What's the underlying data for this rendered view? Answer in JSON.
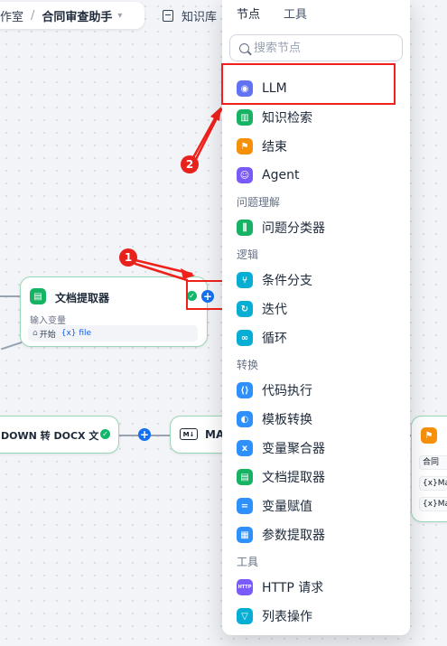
{
  "breadcrumb": {
    "studio": "作室",
    "app_name": "合同审查助手"
  },
  "toolbar": {
    "knowledge": "知识库"
  },
  "panel": {
    "tabs": [
      "节点",
      "工具"
    ],
    "search_placeholder": "搜索节点",
    "items": [
      {
        "label": "LLM",
        "icon": "brain-icon",
        "color": "#6172f3"
      },
      {
        "label": "知识检索",
        "icon": "book-icon",
        "color": "#16b364"
      },
      {
        "label": "结束",
        "icon": "flag-icon",
        "color": "#f79009"
      },
      {
        "label": "Agent",
        "icon": "agent-icon",
        "color": "#7a5af8"
      },
      {
        "label": "问题分类器",
        "icon": "classifier-icon",
        "color": "#16b364"
      },
      {
        "label": "条件分支",
        "icon": "branch-icon",
        "color": "#06aed4"
      },
      {
        "label": "迭代",
        "icon": "iteration-icon",
        "color": "#06aed4"
      },
      {
        "label": "循环",
        "icon": "loop-icon",
        "color": "#06aed4"
      },
      {
        "label": "代码执行",
        "icon": "code-icon",
        "color": "#2e90fa"
      },
      {
        "label": "模板转换",
        "icon": "template-icon",
        "color": "#2e90fa"
      },
      {
        "label": "变量聚合器",
        "icon": "variable-icon",
        "color": "#2e90fa"
      },
      {
        "label": "文档提取器",
        "icon": "document-icon",
        "color": "#16b364"
      },
      {
        "label": "变量赋值",
        "icon": "assign-icon",
        "color": "#2e90fa"
      },
      {
        "label": "参数提取器",
        "icon": "parameter-icon",
        "color": "#2e90fa"
      },
      {
        "label": "HTTP 请求",
        "icon": "http-icon",
        "color": "#7a5af8"
      },
      {
        "label": "列表操作",
        "icon": "filter-icon",
        "color": "#06aed4"
      }
    ],
    "groups": [
      "问题理解",
      "逻辑",
      "转换",
      "工具"
    ]
  },
  "canvas": {
    "doc_node": {
      "title": "文档提取器",
      "input_label": "输入变量",
      "var_source": "开始",
      "var_name": "{x} file"
    },
    "markdown_node": {
      "title": "DOWN 转 DOCX 文"
    },
    "ma_node": {
      "title": "MA"
    },
    "right_node": {
      "rows": [
        "合同",
        "{x}Ma",
        "{x}Ma"
      ]
    }
  },
  "annotations": {
    "badge1": "1",
    "badge2": "2"
  }
}
